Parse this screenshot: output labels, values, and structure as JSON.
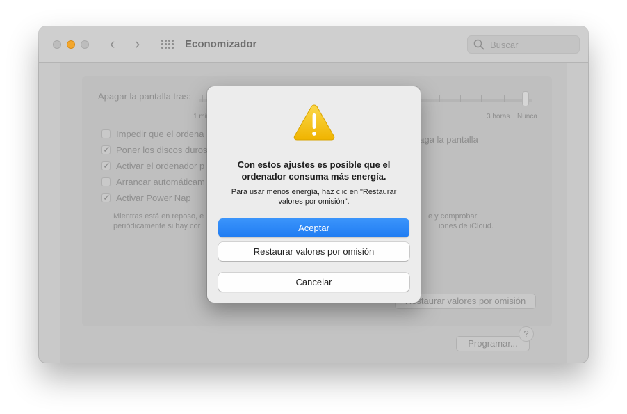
{
  "window": {
    "title": "Economizador",
    "search_placeholder": "Buscar"
  },
  "settings": {
    "turn_off_label": "Apagar la pantalla tras:",
    "slider_labels": {
      "min": "1 min",
      "three_hours": "3 horas",
      "never": "Nunca"
    },
    "slider_value": "Nunca",
    "options": [
      {
        "label": "Impedir que el ordenador entre en reposo automáticamente cuando se apaga la pantalla",
        "checked": false
      },
      {
        "label": "Poner los discos duros en reposo siempre que sea posible",
        "checked": true
      },
      {
        "label": "Activar el ordenador para permitir el acceso a la red",
        "checked": true
      },
      {
        "label": "Arrancar automáticamente después de un corte de suministro eléctrico",
        "checked": false
      },
      {
        "label": "Activar Power Nap",
        "checked": true
      }
    ],
    "option1_prefix": "Impedir que el ordena",
    "option1_suffix": "paga la pantalla",
    "option2_visible": "Poner los discos duros",
    "option3_visible": "Activar el ordenador p",
    "option4_visible": "Arrancar automáticam",
    "power_nap_desc_left_1": "Mientras está en reposo, e",
    "power_nap_desc_left_2": "periódicamente si hay cor",
    "power_nap_desc_right_1": "e y comprobar",
    "power_nap_desc_right_2": "iones de iCloud.",
    "restore_button": "Restaurar valores por omisión",
    "schedule_button": "Programar...",
    "help": "?"
  },
  "dialog": {
    "title": "Con estos ajustes es posible que el ordenador consuma más energía.",
    "message": "Para usar menos energía, haz clic en \"Restaurar valores por omisión\".",
    "accept": "Aceptar",
    "restore": "Restaurar valores por omisión",
    "cancel": "Cancelar",
    "icon": "warning-icon"
  },
  "colors": {
    "accent": "#2482f6",
    "minimize": "#f3a72d",
    "warning": "#f6c000"
  }
}
